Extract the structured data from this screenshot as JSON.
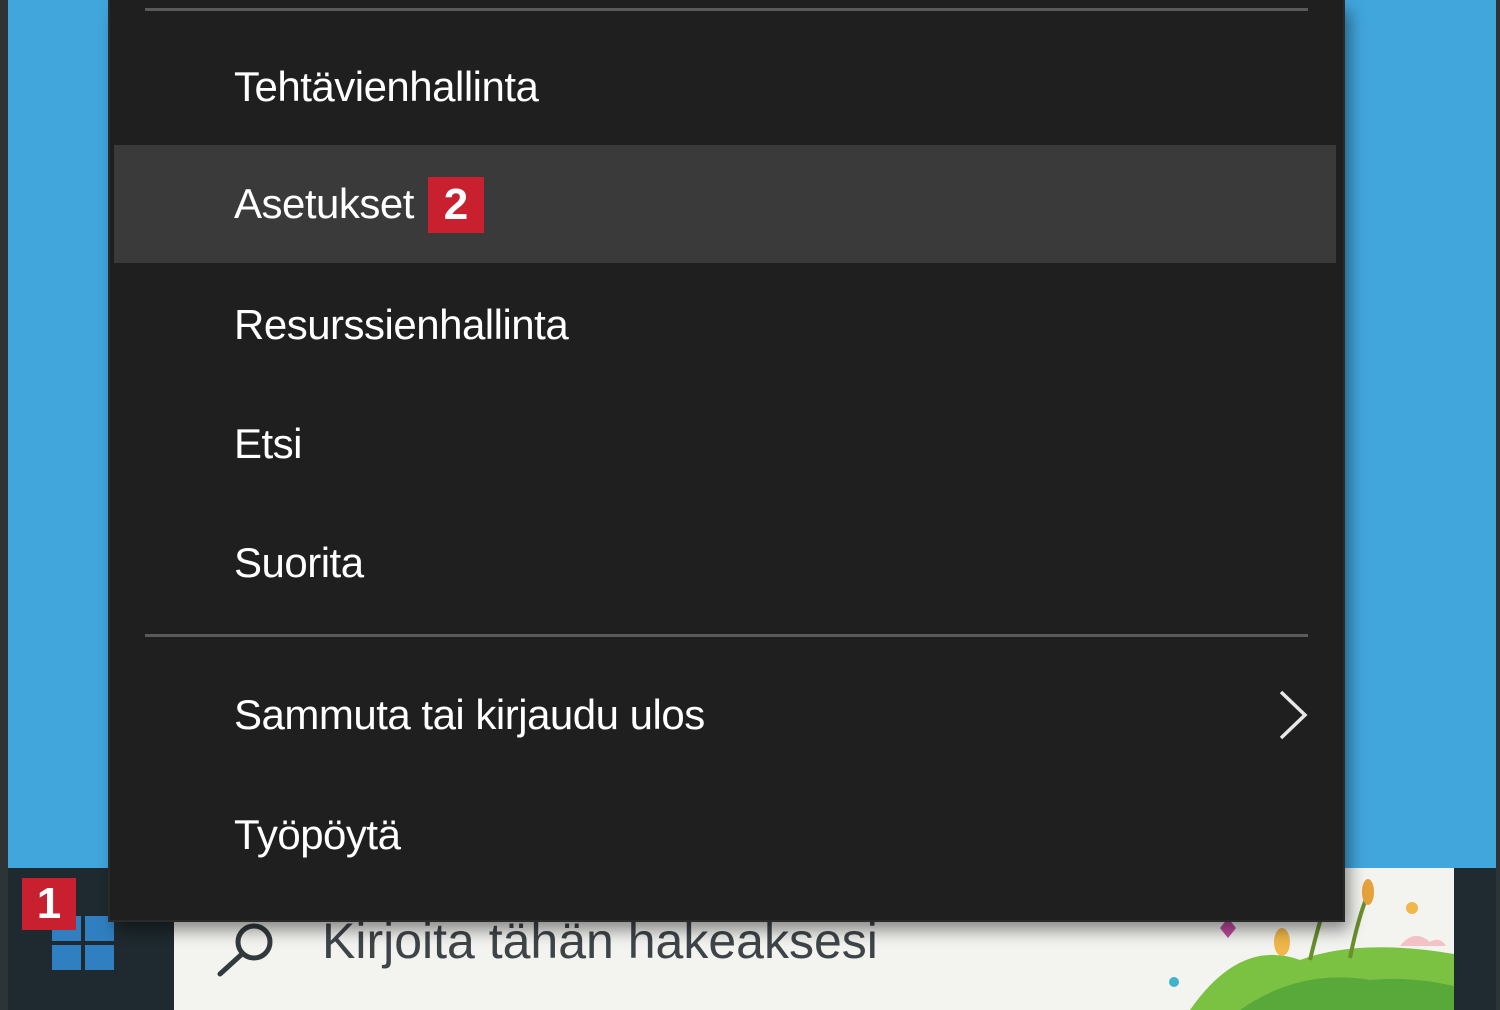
{
  "context_menu": {
    "items": [
      {
        "label": "Tehtävienhallinta"
      },
      {
        "label": "Asetukset"
      },
      {
        "label": "Resurssienhallinta"
      },
      {
        "label": "Etsi"
      },
      {
        "label": "Suorita"
      },
      {
        "label": "Sammuta tai kirjaudu ulos",
        "has_submenu": true
      },
      {
        "label": "Työpöytä"
      }
    ],
    "highlighted_item": "Asetukset"
  },
  "badges": {
    "start": "1",
    "settings": "2"
  },
  "taskbar": {
    "search_placeholder": "Kirjoita tähän hakeaksesi"
  },
  "colors": {
    "desktop": "#41a6dc",
    "menu_bg": "#1f1f1f",
    "menu_hover": "#3a3a3a",
    "badge": "#c8202f",
    "windows_logo": "#2f7fc1"
  }
}
